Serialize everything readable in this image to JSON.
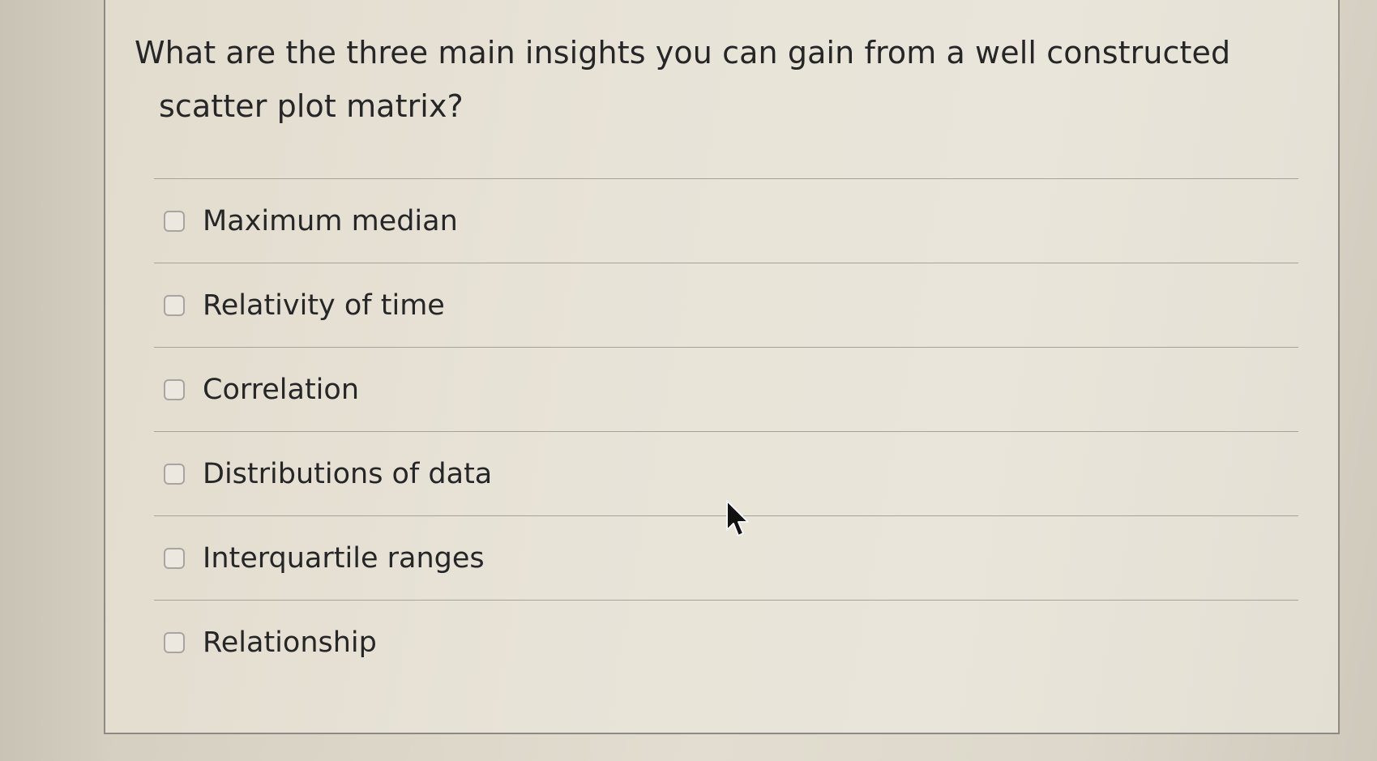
{
  "question": {
    "line1": "What are the three main insights you can gain from a well constructed",
    "line2": "scatter plot matrix?"
  },
  "options": [
    {
      "label": "Maximum median",
      "checked": false
    },
    {
      "label": "Relativity of time",
      "checked": false
    },
    {
      "label": "Correlation",
      "checked": false
    },
    {
      "label": "Distributions of data",
      "checked": false
    },
    {
      "label": "Interquartile ranges",
      "checked": false
    },
    {
      "label": "Relationship",
      "checked": false
    }
  ],
  "icons": {
    "cursor": "mouse-pointer-icon"
  },
  "colors": {
    "text": "#262626",
    "checkbox_border": "#a8a59f",
    "divider": "#a7a39b"
  }
}
